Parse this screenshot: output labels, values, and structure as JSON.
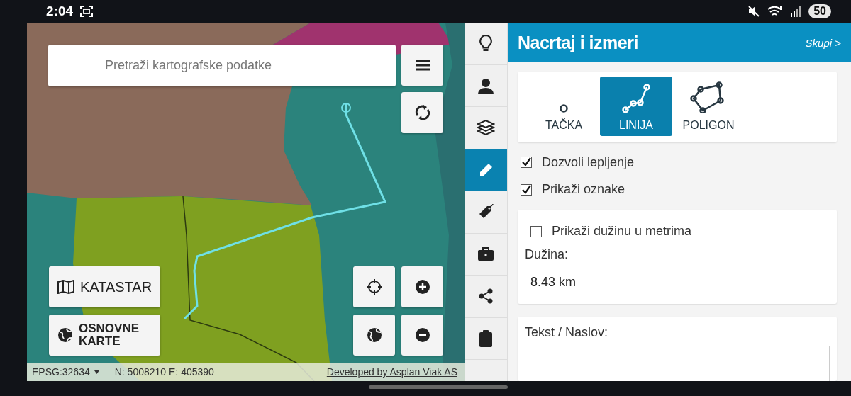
{
  "status_bar": {
    "time": "2:04",
    "battery": "50"
  },
  "map": {
    "search": {
      "placeholder": "Pretraži kartografske podatke"
    },
    "layer_buttons": [
      {
        "label": "KATASTAR"
      },
      {
        "label": "OSNOVNE KARTE"
      }
    ],
    "coordinate_bar": {
      "crs": "EPSG:32634",
      "coordinates": "N: 5008210 E: 405390",
      "credit": "Developed by Asplan Viak AS"
    }
  },
  "sidebar": {
    "items": [
      {
        "selected": false
      },
      {
        "selected": false
      },
      {
        "selected": false
      },
      {
        "selected": true
      },
      {
        "selected": false
      },
      {
        "selected": false
      },
      {
        "selected": false
      },
      {
        "selected": false
      }
    ]
  },
  "panel": {
    "title": "Nacrtaj i izmeri",
    "collapse": "Skupi >",
    "tools": [
      {
        "label": "TAČKA",
        "selected": false
      },
      {
        "label": "LINIJA",
        "selected": true
      },
      {
        "label": "POLIGON",
        "selected": false
      }
    ],
    "options": [
      {
        "label": "Dozvoli lepljenje",
        "checked": true
      },
      {
        "label": "Prikaži oznake",
        "checked": true
      }
    ],
    "length_option": {
      "label": "Prikaži dužinu u metrima",
      "checked": false
    },
    "length": {
      "label": "Dužina:",
      "value": "8.43 km"
    },
    "text_field": {
      "label": "Tekst / Naslov:"
    }
  }
}
